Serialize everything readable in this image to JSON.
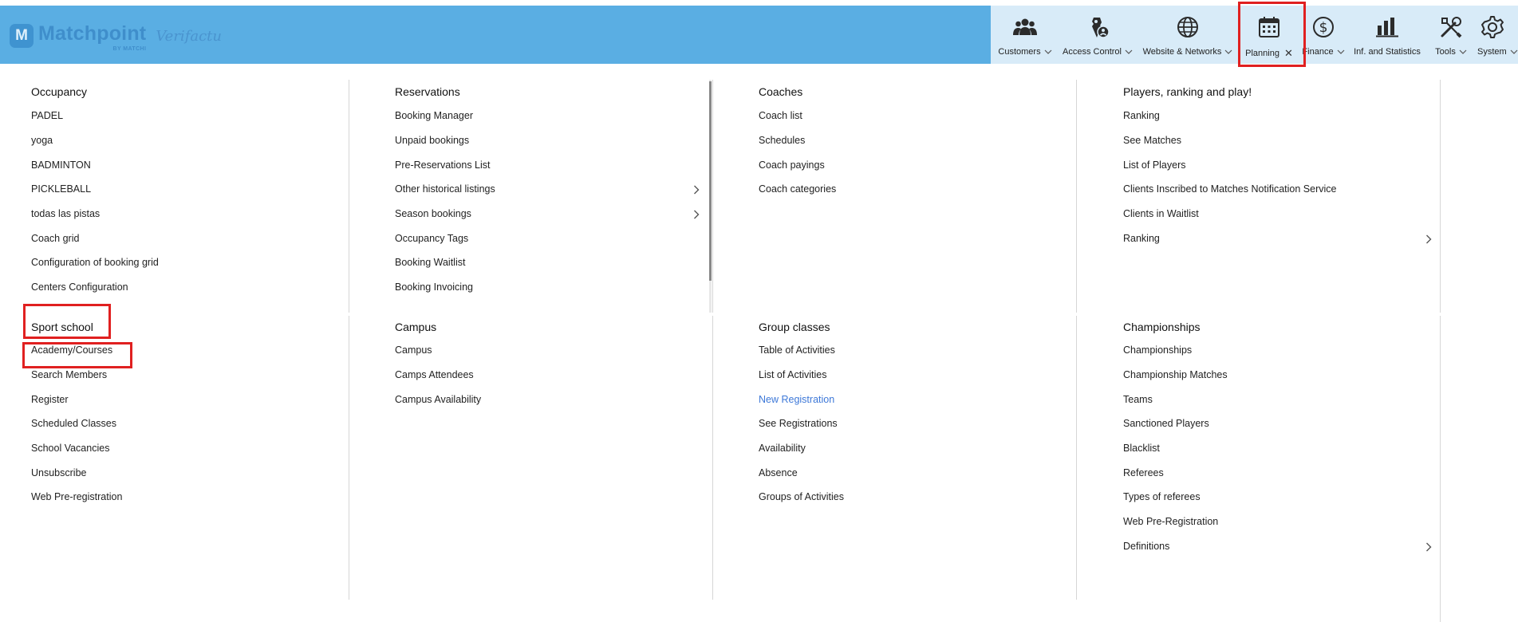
{
  "brand": {
    "name": "Matchpoint",
    "sub": "BY MATCHI",
    "logo_letter": "M",
    "secondary": "Verifactu"
  },
  "nav": [
    {
      "label": "Customers",
      "icon": "users-icon"
    },
    {
      "label": "Access Control",
      "icon": "access-lock-icon"
    },
    {
      "label": "Website & Networks",
      "icon": "globe-icon"
    },
    {
      "label": "Planning",
      "icon": "calendar-icon",
      "active": true
    },
    {
      "label": "Finance",
      "icon": "dollar-icon"
    },
    {
      "label": "Inf. and Statistics",
      "icon": "bar-chart-icon"
    },
    {
      "label": "Tools",
      "icon": "tools-icon"
    },
    {
      "label": "System",
      "icon": "gear-icon"
    }
  ],
  "menu": {
    "occupancy": {
      "title": "Occupancy",
      "items": [
        "PADEL",
        "yoga",
        "BADMINTON",
        "PICKLEBALL",
        "todas las pistas",
        "Coach grid",
        "Configuration of booking grid",
        "Centers Configuration"
      ]
    },
    "reservations": {
      "title": "Reservations",
      "items": [
        "Booking Manager",
        "Unpaid bookings",
        "Pre-Reservations List",
        "Other historical listings",
        "Season bookings",
        "Occupancy Tags",
        "Booking Waitlist",
        "Booking Invoicing"
      ]
    },
    "coaches": {
      "title": "Coaches",
      "items": [
        "Coach list",
        "Schedules",
        "Coach payings",
        "Coach categories"
      ]
    },
    "players": {
      "title": "Players, ranking and play!",
      "items": [
        "Ranking",
        "See Matches",
        "List of Players",
        "Clients Inscribed to Matches Notification Service",
        "Clients in Waitlist",
        "Ranking"
      ]
    },
    "sport_school": {
      "title": "Sport school",
      "items": [
        "Academy/Courses",
        "Search Members",
        "Register",
        "Scheduled Classes",
        "School Vacancies",
        "Unsubscribe",
        "Web Pre-registration"
      ]
    },
    "campus": {
      "title": "Campus",
      "items": [
        "Campus",
        "Camps Attendees",
        "Campus Availability"
      ]
    },
    "group_classes": {
      "title": "Group classes",
      "items": [
        "Table of Activities",
        "List of Activities",
        "New Registration",
        "See Registrations",
        "Availability",
        "Absence",
        "Groups of Activities"
      ]
    },
    "championships": {
      "title": "Championships",
      "items": [
        "Championships",
        "Championship Matches",
        "Teams",
        "Sanctioned Players",
        "Blacklist",
        "Referees",
        "Types of referees",
        "Web Pre-Registration",
        "Definitions"
      ]
    }
  },
  "colors": {
    "header": "#5aaee3",
    "nav_panel": "#d8ebf8",
    "active_link": "#3d78d8",
    "highlight": "#e02020"
  }
}
